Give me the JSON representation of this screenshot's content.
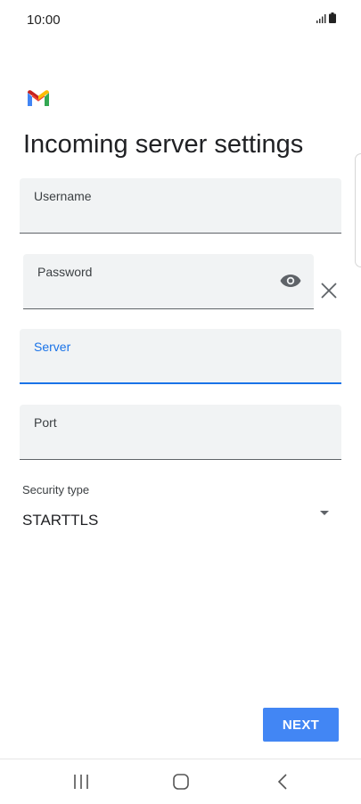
{
  "status_bar": {
    "time": "10:00",
    "icons": [
      "signal-icon",
      "battery-icon"
    ]
  },
  "app": {
    "logo": "gmail-logo",
    "title": "Incoming server settings"
  },
  "form": {
    "username": {
      "label": "Username",
      "value": ""
    },
    "password": {
      "label": "Password",
      "value": "",
      "toggle_icon": "eye-icon",
      "clear_icon": "close-icon"
    },
    "server": {
      "label": "Server",
      "value": "",
      "focused": true
    },
    "port": {
      "label": "Port",
      "value": ""
    },
    "security_type": {
      "label": "Security type",
      "value": "STARTTLS"
    }
  },
  "actions": {
    "next_label": "NEXT"
  },
  "nav_bar": {
    "buttons": [
      "recent-apps-icon",
      "home-icon",
      "back-icon"
    ]
  },
  "colors": {
    "accent": "#1a73e8",
    "button": "#4286f4",
    "field_background": "#f1f3f4"
  }
}
